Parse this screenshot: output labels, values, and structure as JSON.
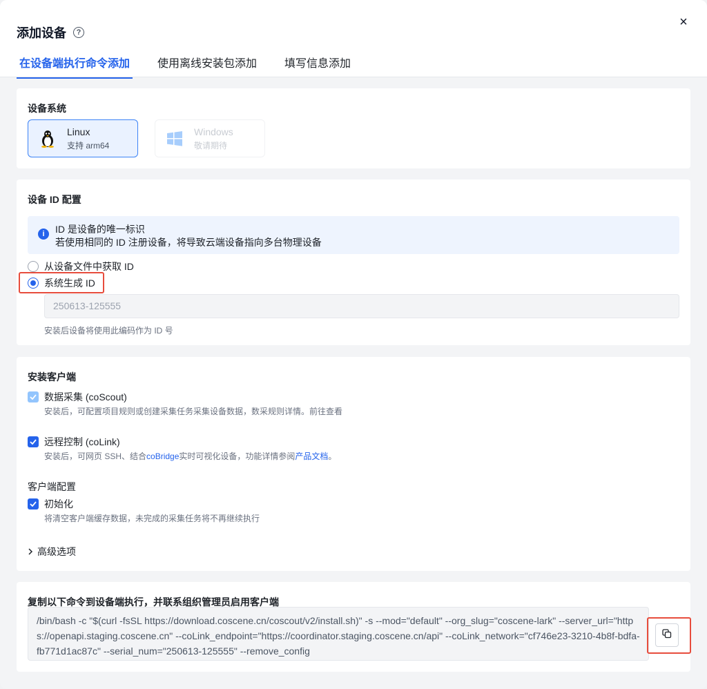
{
  "dialog": {
    "title": "添加设备",
    "close_glyph": "×",
    "help_glyph": "?"
  },
  "tabs": [
    {
      "label": "在设备端执行命令添加",
      "active": true
    },
    {
      "label": "使用离线安装包添加",
      "active": false
    },
    {
      "label": "填写信息添加",
      "active": false
    }
  ],
  "os_section": {
    "title": "设备系统",
    "options": [
      {
        "name": "Linux",
        "sub": "支持 arm64",
        "selected": true,
        "icon": "linux-penguin-icon"
      },
      {
        "name": "Windows",
        "sub": "敬请期待",
        "selected": false,
        "disabled": true,
        "icon": "windows-logo-icon"
      }
    ]
  },
  "id_section": {
    "title": "设备 ID 配置",
    "info_line1": "ID 是设备的唯一标识",
    "info_line2": "若使用相同的 ID 注册设备，将导致云端设备指向多台物理设备",
    "radio_file": "从设备文件中获取 ID",
    "radio_system": "系统生成 ID",
    "selected": "system",
    "id_value": "250613-125555",
    "hint": "安装后设备将使用此编码作为 ID 号"
  },
  "client_section": {
    "title": "安装客户端",
    "cosout_label": "数据采集 (coScout)",
    "cosout_hint": "安装后，可配置项目规则或创建采集任务采集设备数据，数采规则详情。前往查看",
    "colink_label": "远程控制 (coLink)",
    "colink_hint_prefix": "安装后，可网页 SSH、结合",
    "colink_hint_link1": "coBridge",
    "colink_hint_middle": "实时可视化设备，功能详情参阅",
    "colink_hint_link2": "产品文档",
    "colink_hint_suffix": "。",
    "config_title": "客户端配置",
    "init_label": "初始化",
    "init_hint": "将清空客户端缓存数据，未完成的采集任务将不再继续执行",
    "advanced_label": "高级选项"
  },
  "command_section": {
    "title": "复制以下命令到设备端执行，并联系组织管理员启用客户端",
    "command": "/bin/bash -c \"$(curl -fsSL https://download.coscene.cn/coscout/v2/install.sh)\" -s --mod=\"default\" --org_slug=\"coscene-lark\" --server_url=\"https://openapi.staging.coscene.cn\" --coLink_endpoint=\"https://coordinator.staging.coscene.cn/api\" --coLink_network=\"cf746e23-3210-4b8f-bdfa-fb771d1ac87c\" --serial_num=\"250613-125555\" --remove_config"
  },
  "colors": {
    "accent": "#2563eb",
    "highlight": "#e74c3c",
    "selected_bg": "#eaf2ff"
  }
}
